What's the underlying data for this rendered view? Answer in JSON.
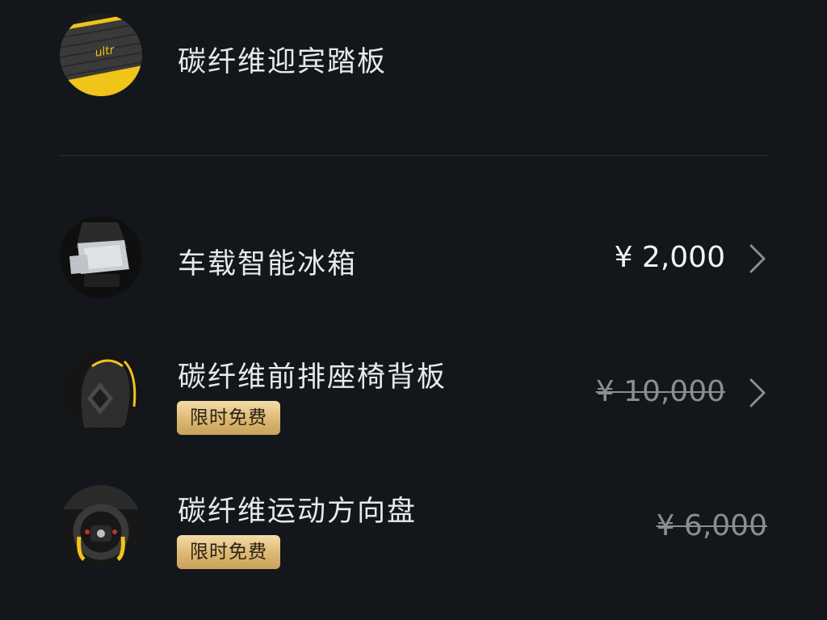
{
  "items": [
    {
      "title": "碳纤维迎宾踏板"
    },
    {
      "title": "车载智能冰箱",
      "price": "¥ 2,000"
    },
    {
      "title": "碳纤维前排座椅背板",
      "badge": "限时免费",
      "price": "¥ 10,000"
    },
    {
      "title": "碳纤维运动方向盘",
      "badge": "限时免费",
      "price": "¥ 6,000"
    }
  ],
  "colors": {
    "background": "#13161b",
    "accent_yellow": "#f0c419",
    "badge_gold": "#dcb873",
    "divider": "#2d3137"
  }
}
